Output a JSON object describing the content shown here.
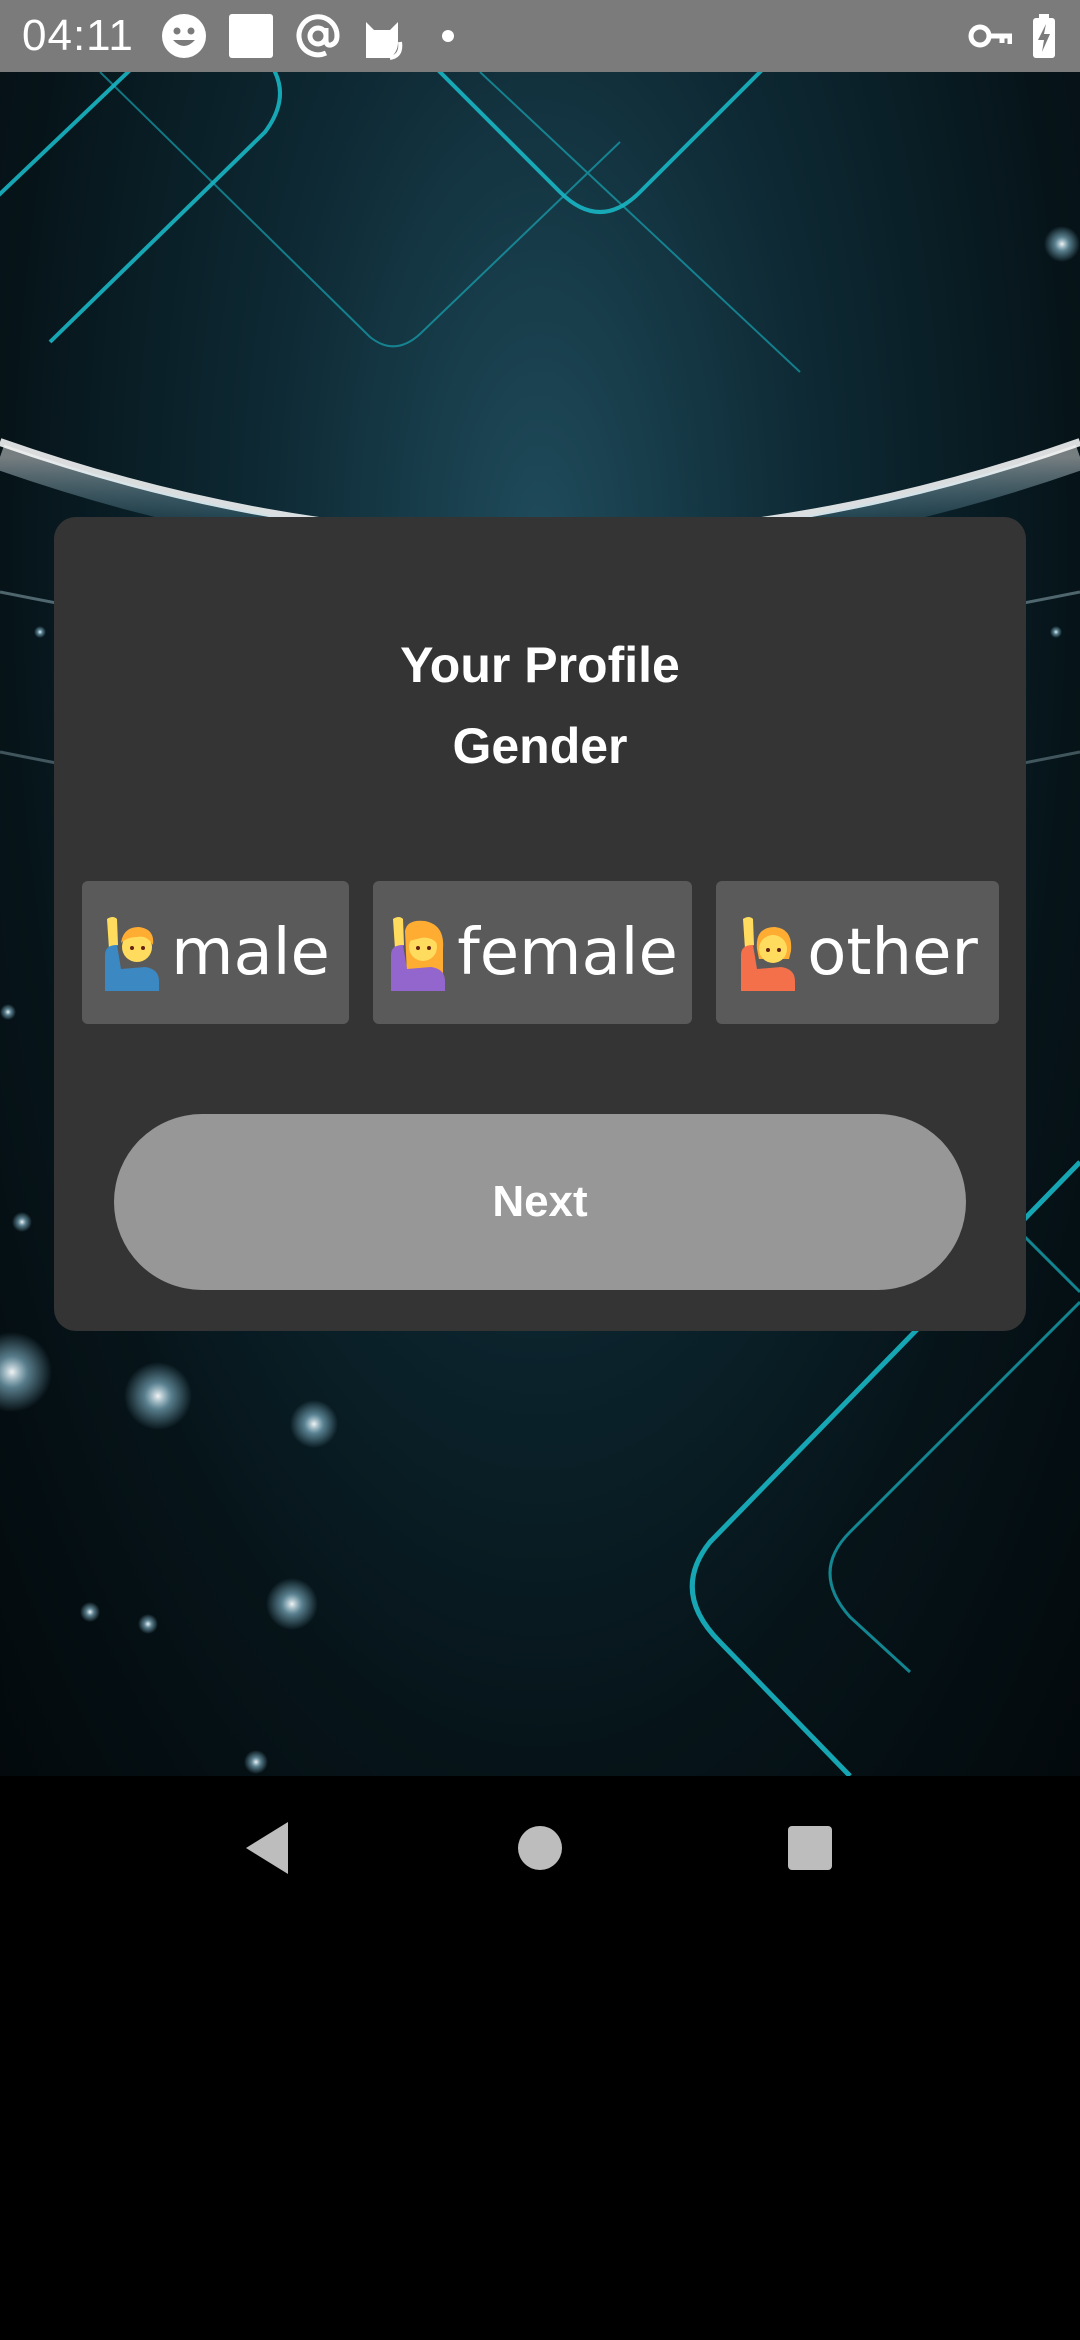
{
  "status_bar": {
    "time": "04:11",
    "icons": [
      "smiley-icon",
      "square-icon",
      "at-sign-icon",
      "cat-icon",
      "dot-icon",
      "vpn-key-icon",
      "battery-charging-icon"
    ]
  },
  "card": {
    "title_line1": "Your Profile",
    "title_line2": "Gender",
    "gender_options": [
      {
        "label": "male",
        "icon": "man-raising-hand-emoji",
        "color": "#3b88c3"
      },
      {
        "label": "female",
        "icon": "woman-raising-hand-emoji",
        "color": "#9266cc"
      },
      {
        "label": "other",
        "icon": "person-raising-hand-emoji",
        "color": "#f4704b"
      }
    ],
    "next_label": "Next"
  },
  "nav_bar": {
    "buttons": [
      "back-icon",
      "home-icon",
      "recents-icon"
    ]
  },
  "colors": {
    "status_bar_bg": "#7b7b7b",
    "card_bg": "#343434",
    "option_bg": "#5a5a5a",
    "next_bg": "#979797",
    "accent_cyan": "#18b6c4"
  }
}
